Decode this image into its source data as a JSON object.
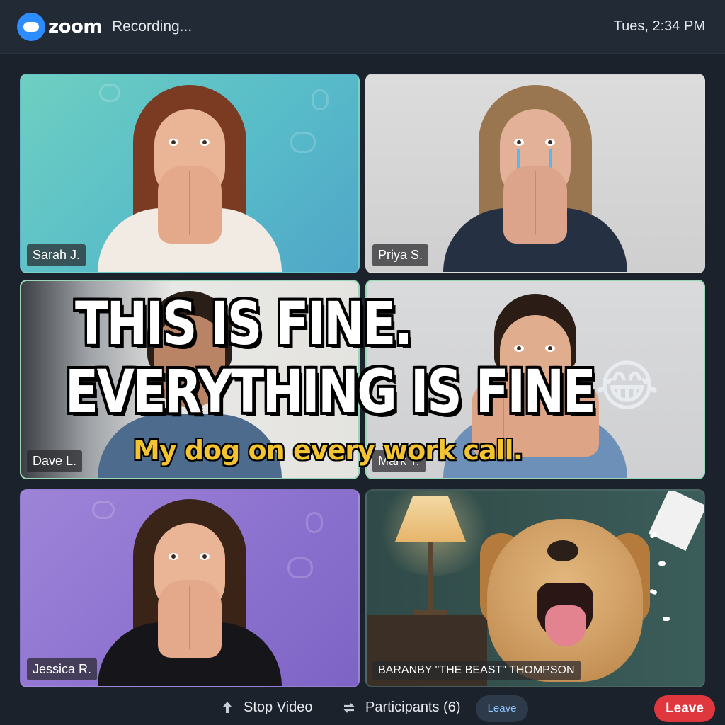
{
  "header": {
    "logo_text": "zoom",
    "status": "Recording...",
    "time": "Tues, 2:34 PM"
  },
  "participants": [
    {
      "name": "Sarah J."
    },
    {
      "name": "Priya S."
    },
    {
      "name": "Dave L."
    },
    {
      "name": "Mark T."
    },
    {
      "name": "Jessica R."
    },
    {
      "name": "BARANBY \"THE BEAST\" THOMPSON"
    }
  ],
  "meme": {
    "line1": "THIS IS FINE.",
    "line2": "EVERYTHING IS FINE",
    "emoji": "😂",
    "caption": "My dog on every work call."
  },
  "toolbar": {
    "stop_video": "Stop Video",
    "participants": "Participants (6)",
    "leave_small": "Leave",
    "leave": "Leave"
  },
  "colors": {
    "brand": "#2d8cff",
    "leave": "#e0373f",
    "caption": "#f4c430"
  }
}
